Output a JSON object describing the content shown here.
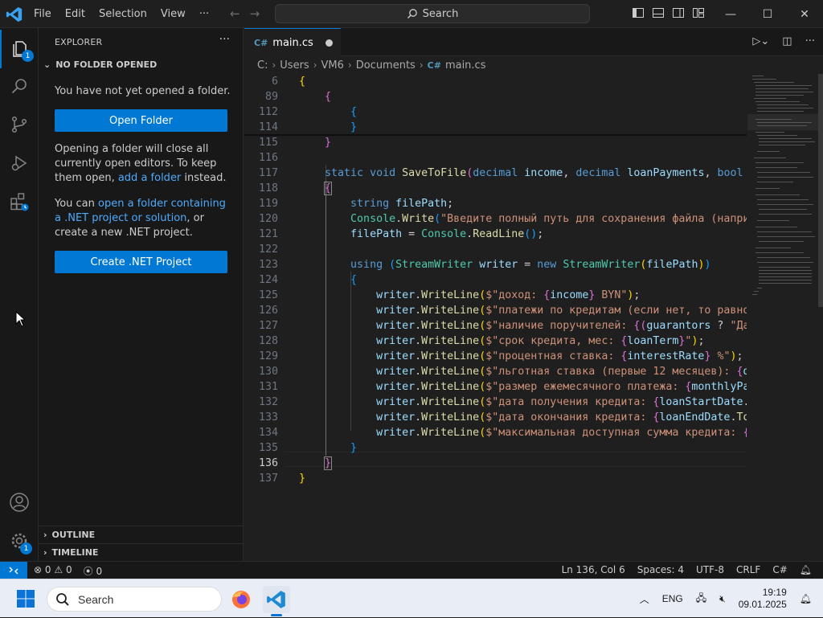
{
  "menu": [
    "File",
    "Edit",
    "Selection",
    "View",
    "···"
  ],
  "search": {
    "label": "Search"
  },
  "activity": {
    "explorer_badge": "1",
    "manage_badge": "1"
  },
  "sidebar": {
    "title": "EXPLORER",
    "section": "NO FOLDER OPENED",
    "not_opened": "You have not yet opened a folder.",
    "open_folder_btn": "Open Folder",
    "warn_part1": "Opening a folder will close all currently open editors. To keep them open, ",
    "warn_link": "add a folder",
    "warn_part2": " instead.",
    "net_part1": "You can ",
    "net_link": "open a folder containing a .NET project or solution",
    "net_part2": ", or create a new .NET project.",
    "create_btn": "Create .NET Project",
    "outline": "OUTLINE",
    "timeline": "TIMELINE"
  },
  "tab": {
    "label": "main.cs",
    "modified": true
  },
  "breadcrumb": [
    "C:",
    "Users",
    "VM6",
    "Documents",
    "main.cs"
  ],
  "editor": {
    "line_numbers": [
      "6",
      "89",
      "112",
      "114",
      "115",
      "116",
      "117",
      "118",
      "119",
      "120",
      "121",
      "122",
      "123",
      "124",
      "125",
      "126",
      "127",
      "128",
      "129",
      "130",
      "131",
      "132",
      "133",
      "134",
      "135",
      "136",
      "137"
    ],
    "current_line": "136"
  },
  "status": {
    "errors": "0",
    "warnings": "0",
    "ports": "0",
    "position": "Ln 136, Col 6",
    "spaces": "Spaces: 4",
    "encoding": "UTF-8",
    "eol": "CRLF",
    "language": "C#"
  },
  "taskbar": {
    "search": "Search",
    "lang": "ENG",
    "time": "19:19",
    "date": "09.01.2025"
  },
  "colors": {
    "accent": "#0078d4",
    "keyword": "#569cd6",
    "type": "#4ec9b0",
    "function": "#dcdcaa",
    "variable": "#9cdcfe",
    "string": "#ce9178"
  }
}
